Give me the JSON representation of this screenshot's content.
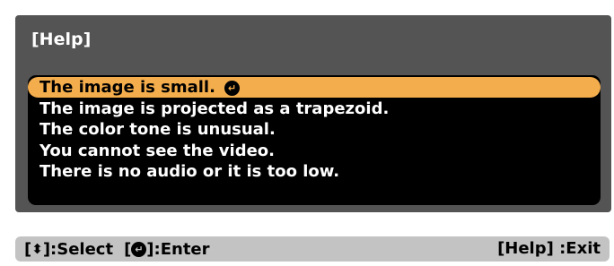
{
  "dialog": {
    "title": "[Help]",
    "items": [
      {
        "label": "The image is small."
      },
      {
        "label": "The image is projected as a trapezoid."
      },
      {
        "label": "The color tone is unusual."
      },
      {
        "label": "You cannot see the video."
      },
      {
        "label": "There is no audio or it is too low."
      }
    ],
    "selected_index": 0,
    "enter_icon": "enter-icon"
  },
  "footer": {
    "select_hint": "]:Select",
    "enter_hint": "]:Enter",
    "exit_hint": "[Help] :Exit",
    "updown_icon": "up-down-arrow-icon",
    "enter_icon": "enter-icon"
  },
  "colors": {
    "panel_bg": "#545454",
    "menu_bg": "#000000",
    "highlight": "#f4ad4c",
    "footer_bg": "#c3c3c3"
  }
}
